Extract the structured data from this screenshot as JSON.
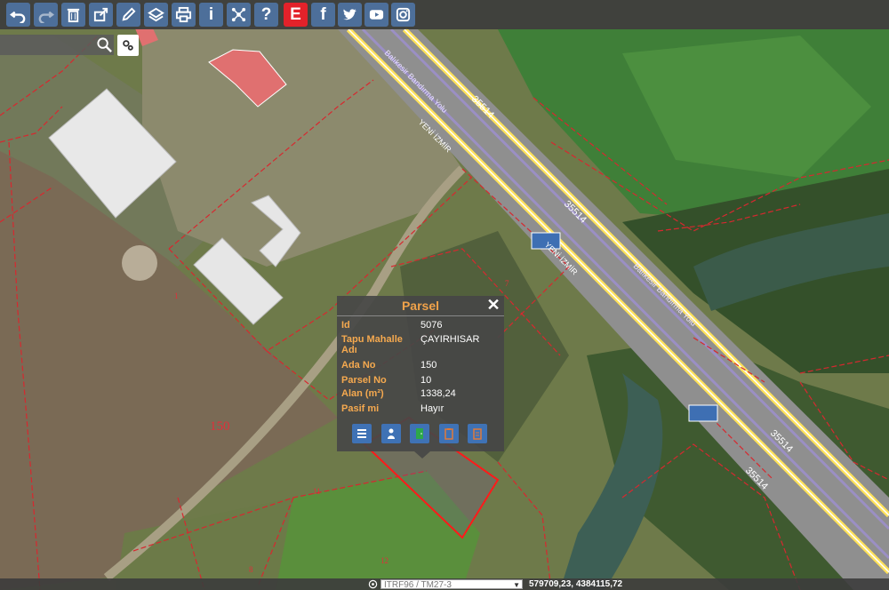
{
  "toolbar": {
    "buttons": [
      {
        "name": "undo-button",
        "icon": "undo-icon"
      },
      {
        "name": "redo-button",
        "icon": "redo-icon"
      },
      {
        "name": "delete-button",
        "icon": "trash-icon"
      },
      {
        "name": "share-button",
        "icon": "share-icon"
      },
      {
        "name": "draw-button",
        "icon": "pencil-icon"
      },
      {
        "name": "layers-button",
        "icon": "layers-icon"
      },
      {
        "name": "print-button",
        "icon": "printer-icon"
      },
      {
        "name": "info-button",
        "icon": "info-icon",
        "glyph": "i"
      },
      {
        "name": "network-button",
        "icon": "network-icon"
      },
      {
        "name": "help-button",
        "icon": "question-icon",
        "glyph": "?"
      },
      {
        "name": "e-button",
        "icon": "e-logo-icon",
        "glyph": "E"
      },
      {
        "name": "facebook-button",
        "icon": "facebook-icon",
        "glyph": "f"
      },
      {
        "name": "twitter-button",
        "icon": "twitter-icon"
      },
      {
        "name": "youtube-button",
        "icon": "youtube-icon"
      },
      {
        "name": "instagram-button",
        "icon": "instagram-icon"
      }
    ]
  },
  "map": {
    "block_label": "150",
    "parcel_labels": [
      "7",
      "11",
      "12",
      "8",
      "1"
    ],
    "road_labels": [
      "35514",
      "35514",
      "35514",
      "35514",
      "YENİ İZMİR",
      "YENİ İZMİR",
      "Balıkesir Bandırma Yolu",
      "Balıkesir Bandırma Yolu"
    ]
  },
  "popup": {
    "title": "Parsel",
    "close": "✕",
    "rows": [
      {
        "key": "Id",
        "value": "5076"
      },
      {
        "key": "Tapu Mahalle Adı",
        "value": "ÇAYIRHISAR"
      },
      {
        "key": "Ada No",
        "value": "150"
      },
      {
        "key": "Parsel No",
        "value": "10"
      },
      {
        "key": "Alan (m²)",
        "value": "1338,24"
      },
      {
        "key": "Pasif mi",
        "value": "Hayır"
      }
    ],
    "actions": [
      "list-icon",
      "person-icon",
      "door-icon",
      "clipboard-icon",
      "clipboard-list-icon"
    ]
  },
  "statusbar": {
    "crs": "ITRF96 / TM27-3",
    "coords": "579709,23, 4384115,72"
  },
  "colors": {
    "toolbar_button": "#4d6f9a",
    "e_button": "#e3222a",
    "parcel_line": "#d7282f",
    "highlight": "#ff1a1a",
    "popup_key": "#f5a94f",
    "road_yellow": "#ffe25a"
  }
}
